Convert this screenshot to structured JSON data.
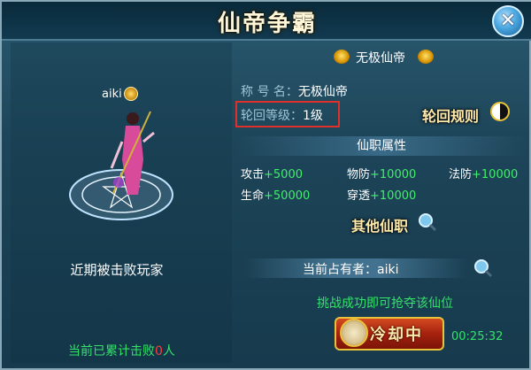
{
  "window": {
    "title": "仙帝争霸"
  },
  "player": {
    "name": "aiki"
  },
  "rank": {
    "name": "无极仙帝"
  },
  "info": {
    "title_label": "称 号 名：",
    "title_value": "无极仙帝",
    "level_label": "轮回等级：",
    "level_value": "1级"
  },
  "links": {
    "rules": "轮回规则",
    "other_posts": "其他仙职"
  },
  "attributes": {
    "header": "仙职属性",
    "stats": [
      {
        "label": "攻击",
        "value": "+5000"
      },
      {
        "label": "物防",
        "value": "+10000"
      },
      {
        "label": "法防",
        "value": "+10000"
      },
      {
        "label": "生命",
        "value": "+50000"
      },
      {
        "label": "穿透",
        "value": "+10000"
      }
    ]
  },
  "left": {
    "defeated_title": "近期被击败玩家",
    "defeat_count_prefix": "当前已累计击败",
    "defeat_count_value": "0",
    "defeat_count_suffix": "人"
  },
  "owner": {
    "label": "当前占有者：",
    "name": "aiki"
  },
  "challenge": {
    "text": "挑战成功即可抢夺该仙位"
  },
  "cooldown": {
    "button_label": "冷却中",
    "timer": "00:25:32"
  },
  "icons": {
    "close": "close-icon",
    "rules": "yin-yang-icon",
    "search": "magnifier-icon",
    "clock": "clock-icon",
    "emblem": "rank-emblem-icon"
  }
}
